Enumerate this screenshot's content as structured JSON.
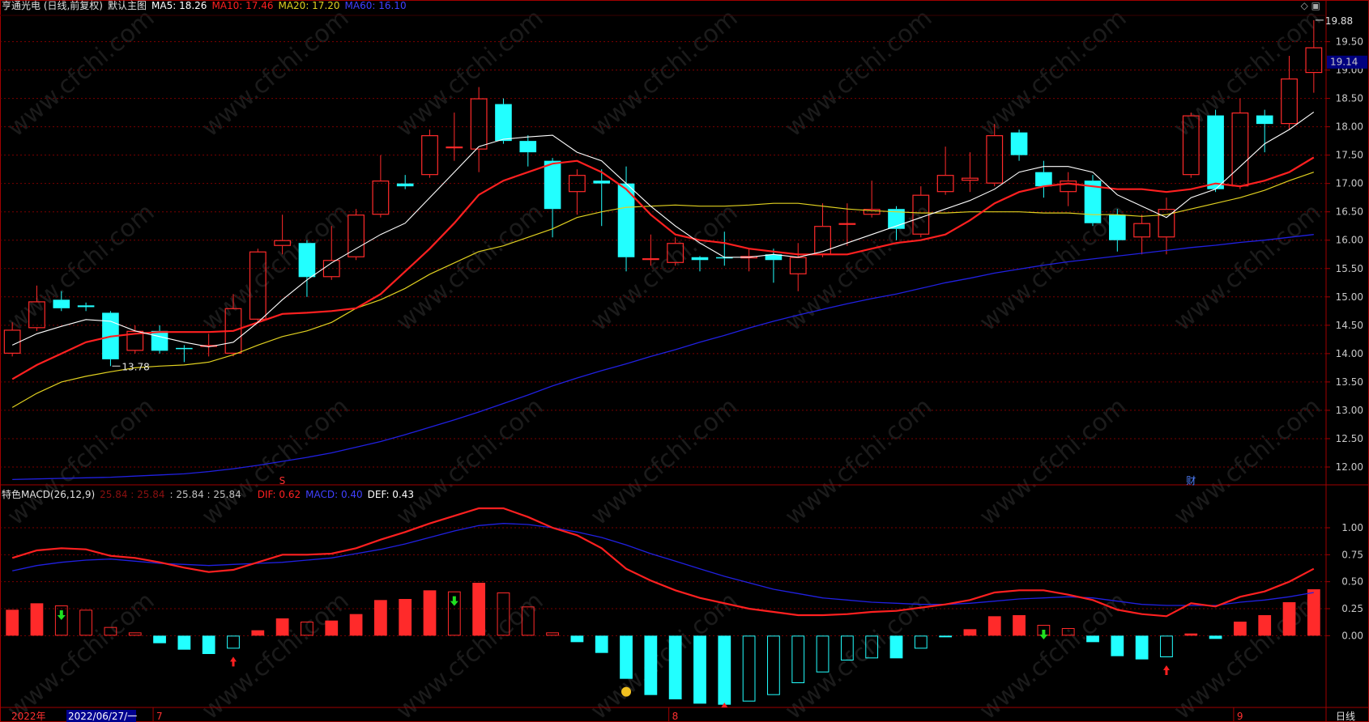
{
  "header": {
    "title": "亨通光电 (日线,前复权)",
    "main_label": "默认主图",
    "ma5": "MA5: 18.26",
    "ma10": "MA10: 17.46",
    "ma20": "MA20: 17.20",
    "ma60": "MA60: 16.10"
  },
  "colors": {
    "ma5": "#ffffff",
    "ma10": "#ff2020",
    "ma20": "#e0d020",
    "ma60": "#2020e0",
    "up": "#ff2a2a",
    "down": "#22ffff",
    "grid": "#7a0000",
    "frame": "#a00000"
  },
  "watermark": "www.cfchi.com",
  "price_axis": {
    "ticks": [
      "19.50",
      "19.00",
      "18.50",
      "18.00",
      "17.50",
      "17.00",
      "16.50",
      "16.00",
      "15.50",
      "15.00",
      "14.50",
      "14.00",
      "13.50",
      "13.00",
      "12.50",
      "12.00"
    ],
    "current": "19.14"
  },
  "macd_panel": {
    "title": "特色MACD(26,12,9)",
    "vals1": "25.84 : 25.84",
    "vals2": ": 25.84 : 25.84",
    "dif": "DIF: 0.62",
    "macd": "MACD: 0.40",
    "def": "DEF: 0.43",
    "ticks": [
      "1.00",
      "0.75",
      "0.50",
      "0.25",
      "0.00"
    ]
  },
  "markers": {
    "s": "S",
    "cai": "财"
  },
  "bottom_axis": {
    "year": "2022年",
    "date": "2022/06/27/一",
    "m7": "7",
    "m8": "8",
    "m9": "9",
    "period": "日线"
  },
  "chart_data": [
    {
      "type": "candlestick",
      "title": "亨通光电 (日线,前复权)",
      "ylim": [
        11.7,
        19.95
      ],
      "candles": [
        {
          "o": 14.0,
          "h": 14.55,
          "l": 13.95,
          "c": 14.42
        },
        {
          "o": 14.45,
          "h": 15.2,
          "l": 14.4,
          "c": 14.92
        },
        {
          "o": 14.95,
          "h": 15.1,
          "l": 14.75,
          "c": 14.8
        },
        {
          "o": 14.85,
          "h": 14.9,
          "l": 14.75,
          "c": 14.82
        },
        {
          "o": 14.72,
          "h": 14.75,
          "l": 13.78,
          "c": 13.9
        },
        {
          "o": 14.05,
          "h": 14.5,
          "l": 14.0,
          "c": 14.4
        },
        {
          "o": 14.4,
          "h": 14.5,
          "l": 14.0,
          "c": 14.05
        },
        {
          "o": 14.1,
          "h": 14.15,
          "l": 13.85,
          "c": 14.08
        },
        {
          "o": 14.12,
          "h": 14.35,
          "l": 13.95,
          "c": 14.15
        },
        {
          "o": 14.0,
          "h": 15.05,
          "l": 13.95,
          "c": 14.8
        },
        {
          "o": 14.6,
          "h": 15.85,
          "l": 14.55,
          "c": 15.8
        },
        {
          "o": 15.9,
          "h": 16.45,
          "l": 15.75,
          "c": 16.0
        },
        {
          "o": 15.95,
          "h": 16.0,
          "l": 15.0,
          "c": 15.35
        },
        {
          "o": 15.35,
          "h": 16.25,
          "l": 15.3,
          "c": 15.65
        },
        {
          "o": 15.7,
          "h": 16.55,
          "l": 15.65,
          "c": 16.45
        },
        {
          "o": 16.45,
          "h": 17.5,
          "l": 16.4,
          "c": 17.05
        },
        {
          "o": 17.0,
          "h": 17.15,
          "l": 16.9,
          "c": 16.95
        },
        {
          "o": 17.15,
          "h": 17.95,
          "l": 17.1,
          "c": 17.85
        },
        {
          "o": 17.65,
          "h": 18.25,
          "l": 17.4,
          "c": 17.65
        },
        {
          "o": 17.6,
          "h": 18.7,
          "l": 17.2,
          "c": 18.5
        },
        {
          "o": 18.4,
          "h": 18.5,
          "l": 17.7,
          "c": 17.75
        },
        {
          "o": 17.75,
          "h": 17.85,
          "l": 17.3,
          "c": 17.55
        },
        {
          "o": 17.4,
          "h": 17.45,
          "l": 16.05,
          "c": 16.55
        },
        {
          "o": 16.85,
          "h": 17.25,
          "l": 16.45,
          "c": 17.15
        },
        {
          "o": 17.05,
          "h": 17.25,
          "l": 16.25,
          "c": 17.0
        },
        {
          "o": 17.0,
          "h": 17.3,
          "l": 15.45,
          "c": 15.7
        },
        {
          "o": 15.68,
          "h": 16.1,
          "l": 15.55,
          "c": 15.68
        },
        {
          "o": 15.6,
          "h": 16.05,
          "l": 15.55,
          "c": 15.95
        },
        {
          "o": 15.7,
          "h": 15.72,
          "l": 15.45,
          "c": 15.65
        },
        {
          "o": 15.7,
          "h": 16.15,
          "l": 15.55,
          "c": 15.68
        },
        {
          "o": 15.68,
          "h": 15.85,
          "l": 15.45,
          "c": 15.72
        },
        {
          "o": 15.75,
          "h": 15.85,
          "l": 15.25,
          "c": 15.65
        },
        {
          "o": 15.4,
          "h": 15.95,
          "l": 15.1,
          "c": 15.7
        },
        {
          "o": 15.75,
          "h": 16.65,
          "l": 15.7,
          "c": 16.25
        },
        {
          "o": 16.3,
          "h": 16.65,
          "l": 15.9,
          "c": 16.3
        },
        {
          "o": 16.45,
          "h": 17.05,
          "l": 16.4,
          "c": 16.55
        },
        {
          "o": 16.55,
          "h": 16.6,
          "l": 16.0,
          "c": 16.2
        },
        {
          "o": 16.1,
          "h": 16.95,
          "l": 16.05,
          "c": 16.8
        },
        {
          "o": 16.85,
          "h": 17.65,
          "l": 16.8,
          "c": 17.15
        },
        {
          "o": 17.05,
          "h": 17.55,
          "l": 16.85,
          "c": 17.1
        },
        {
          "o": 17.0,
          "h": 18.05,
          "l": 16.95,
          "c": 17.85
        },
        {
          "o": 17.9,
          "h": 17.95,
          "l": 17.4,
          "c": 17.5
        },
        {
          "o": 17.2,
          "h": 17.4,
          "l": 16.75,
          "c": 16.95
        },
        {
          "o": 16.85,
          "h": 17.2,
          "l": 16.6,
          "c": 17.05
        },
        {
          "o": 17.05,
          "h": 17.15,
          "l": 16.25,
          "c": 16.3
        },
        {
          "o": 16.45,
          "h": 16.55,
          "l": 15.8,
          "c": 16.0
        },
        {
          "o": 16.05,
          "h": 16.45,
          "l": 15.75,
          "c": 16.3
        },
        {
          "o": 16.05,
          "h": 16.75,
          "l": 15.75,
          "c": 16.55
        },
        {
          "o": 17.15,
          "h": 18.25,
          "l": 17.1,
          "c": 18.2
        },
        {
          "o": 18.2,
          "h": 18.3,
          "l": 16.85,
          "c": 16.9
        },
        {
          "o": 16.95,
          "h": 18.5,
          "l": 16.9,
          "c": 18.25
        },
        {
          "o": 18.2,
          "h": 18.3,
          "l": 17.55,
          "c": 18.05
        },
        {
          "o": 18.05,
          "h": 19.25,
          "l": 17.95,
          "c": 18.85
        },
        {
          "o": 18.95,
          "h": 19.88,
          "l": 18.6,
          "c": 19.4
        }
      ],
      "ma5": [
        14.15,
        14.35,
        14.48,
        14.6,
        14.57,
        14.4,
        14.3,
        14.2,
        14.12,
        14.2,
        14.55,
        14.95,
        15.3,
        15.6,
        15.85,
        16.1,
        16.3,
        16.75,
        17.2,
        17.65,
        17.78,
        17.82,
        17.85,
        17.55,
        17.4,
        17.0,
        16.6,
        16.25,
        15.95,
        15.7,
        15.7,
        15.75,
        15.7,
        15.8,
        15.95,
        16.1,
        16.25,
        16.4,
        16.55,
        16.7,
        16.9,
        17.2,
        17.3,
        17.3,
        17.2,
        16.8,
        16.6,
        16.4,
        16.75,
        16.9,
        17.3,
        17.7,
        17.95,
        18.26
      ],
      "ma10": [
        13.55,
        13.8,
        14.0,
        14.2,
        14.3,
        14.35,
        14.38,
        14.38,
        14.38,
        14.4,
        14.55,
        14.7,
        14.72,
        14.75,
        14.8,
        15.05,
        15.45,
        15.85,
        16.3,
        16.8,
        17.05,
        17.2,
        17.35,
        17.4,
        17.2,
        16.9,
        16.45,
        16.1,
        16.0,
        15.95,
        15.85,
        15.8,
        15.75,
        15.75,
        15.75,
        15.85,
        15.95,
        16.0,
        16.1,
        16.35,
        16.65,
        16.85,
        16.95,
        17.0,
        16.95,
        16.9,
        16.9,
        16.85,
        16.9,
        17.0,
        16.95,
        17.05,
        17.2,
        17.46
      ],
      "ma20": [
        13.05,
        13.3,
        13.5,
        13.6,
        13.68,
        13.75,
        13.78,
        13.8,
        13.85,
        13.98,
        14.15,
        14.3,
        14.4,
        14.55,
        14.8,
        14.95,
        15.15,
        15.4,
        15.6,
        15.8,
        15.9,
        16.05,
        16.2,
        16.4,
        16.5,
        16.58,
        16.6,
        16.62,
        16.6,
        16.6,
        16.62,
        16.65,
        16.65,
        16.6,
        16.55,
        16.52,
        16.5,
        16.48,
        16.48,
        16.5,
        16.5,
        16.5,
        16.48,
        16.48,
        16.45,
        16.45,
        16.42,
        16.45,
        16.55,
        16.65,
        16.75,
        16.88,
        17.05,
        17.2
      ],
      "ma60": [
        11.78,
        11.79,
        11.8,
        11.81,
        11.82,
        11.84,
        11.86,
        11.88,
        11.92,
        11.97,
        12.03,
        12.1,
        12.17,
        12.25,
        12.35,
        12.45,
        12.57,
        12.7,
        12.83,
        12.97,
        13.12,
        13.27,
        13.43,
        13.57,
        13.7,
        13.82,
        13.95,
        14.07,
        14.2,
        14.32,
        14.45,
        14.57,
        14.68,
        14.78,
        14.88,
        14.97,
        15.05,
        15.15,
        15.25,
        15.33,
        15.42,
        15.49,
        15.56,
        15.62,
        15.67,
        15.72,
        15.77,
        15.82,
        15.87,
        15.91,
        15.96,
        16.0,
        16.05,
        16.1
      ],
      "annotations": [
        {
          "label": "13.78",
          "index": 4
        },
        {
          "label": "19.88",
          "index": 53
        }
      ]
    },
    {
      "type": "macd",
      "title": "特色MACD(26,12,9)",
      "ylim": [
        -0.65,
        1.3
      ],
      "hist": [
        0.24,
        0.3,
        0.28,
        0.24,
        0.08,
        0.03,
        -0.07,
        -0.13,
        -0.17,
        -0.12,
        0.05,
        0.16,
        0.13,
        0.14,
        0.2,
        0.33,
        0.34,
        0.42,
        0.41,
        0.49,
        0.4,
        0.27,
        0.03,
        -0.06,
        -0.16,
        -0.4,
        -0.55,
        -0.59,
        -0.63,
        -0.64,
        -0.61,
        -0.55,
        -0.44,
        -0.34,
        -0.23,
        -0.21,
        -0.21,
        -0.12,
        -0.01,
        0.06,
        0.18,
        0.19,
        0.1,
        0.07,
        -0.06,
        -0.19,
        -0.22,
        -0.2,
        0.02,
        -0.03,
        0.13,
        0.19,
        0.31,
        0.43
      ],
      "dif": [
        0.72,
        0.79,
        0.81,
        0.8,
        0.74,
        0.72,
        0.68,
        0.63,
        0.59,
        0.61,
        0.68,
        0.75,
        0.75,
        0.76,
        0.81,
        0.89,
        0.96,
        1.04,
        1.11,
        1.18,
        1.18,
        1.1,
        1.0,
        0.93,
        0.81,
        0.62,
        0.51,
        0.42,
        0.35,
        0.3,
        0.25,
        0.22,
        0.19,
        0.19,
        0.2,
        0.22,
        0.23,
        0.26,
        0.29,
        0.33,
        0.4,
        0.42,
        0.42,
        0.38,
        0.33,
        0.24,
        0.2,
        0.18,
        0.3,
        0.27,
        0.36,
        0.41,
        0.5,
        0.62
      ],
      "dea": [
        0.6,
        0.65,
        0.68,
        0.7,
        0.71,
        0.69,
        0.67,
        0.66,
        0.65,
        0.66,
        0.67,
        0.68,
        0.7,
        0.72,
        0.76,
        0.8,
        0.85,
        0.91,
        0.97,
        1.02,
        1.04,
        1.03,
        1.0,
        0.96,
        0.91,
        0.84,
        0.76,
        0.69,
        0.62,
        0.55,
        0.49,
        0.43,
        0.39,
        0.35,
        0.33,
        0.31,
        0.3,
        0.29,
        0.29,
        0.3,
        0.32,
        0.34,
        0.35,
        0.36,
        0.35,
        0.32,
        0.29,
        0.28,
        0.28,
        0.28,
        0.31,
        0.33,
        0.36,
        0.4
      ],
      "signals_down": [
        2,
        18,
        42
      ],
      "signals_up": [
        9,
        47
      ]
    }
  ]
}
